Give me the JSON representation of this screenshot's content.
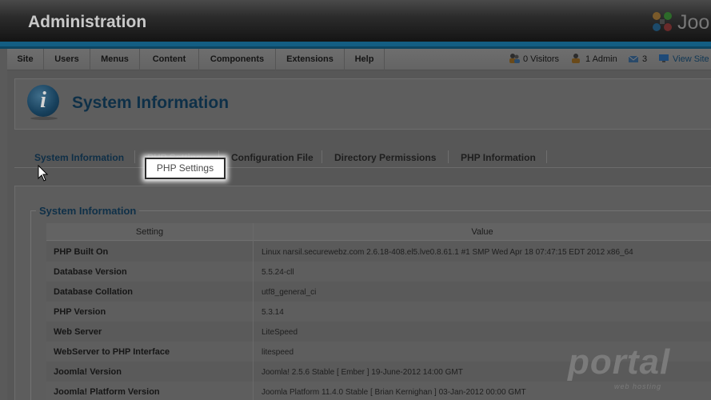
{
  "header": {
    "title": "Administration",
    "logo_text": "Joo"
  },
  "menu": [
    "Site",
    "Users",
    "Menus",
    "Content",
    "Components",
    "Extensions",
    "Help"
  ],
  "status": {
    "visitors": "0 Visitors",
    "admins": "1 Admin",
    "messages": "3",
    "view_site": "View Site"
  },
  "page": {
    "title": "System Information",
    "icon": "info-icon"
  },
  "tabs": [
    "System Information",
    "PHP Settings",
    "Configuration File",
    "Directory Permissions",
    "PHP Information"
  ],
  "tooltip": "PHP Settings",
  "section": {
    "legend": "System Information",
    "columns": [
      "Setting",
      "Value"
    ],
    "rows": [
      {
        "setting": "PHP Built On",
        "value": "Linux narsil.securewebz.com 2.6.18-408.el5.lve0.8.61.1 #1 SMP Wed Apr 18 07:47:15 EDT 2012 x86_64"
      },
      {
        "setting": "Database Version",
        "value": "5.5.24-cll"
      },
      {
        "setting": "Database Collation",
        "value": "utf8_general_ci"
      },
      {
        "setting": "PHP Version",
        "value": "5.3.14"
      },
      {
        "setting": "Web Server",
        "value": "LiteSpeed"
      },
      {
        "setting": "WebServer to PHP Interface",
        "value": "litespeed"
      },
      {
        "setting": "Joomla! Version",
        "value": "Joomla! 2.5.6 Stable [ Ember ] 19-June-2012 14:00 GMT"
      },
      {
        "setting": "Joomla! Platform Version",
        "value": "Joomla Platform 11.4.0 Stable [ Brian Kernighan ] 03-Jan-2012 00:00 GMT"
      }
    ]
  },
  "watermark": {
    "main": "portal",
    "sub": "web hosting"
  },
  "colors": {
    "accent_blue": "#135e83",
    "title_blue": "#0e3048"
  }
}
